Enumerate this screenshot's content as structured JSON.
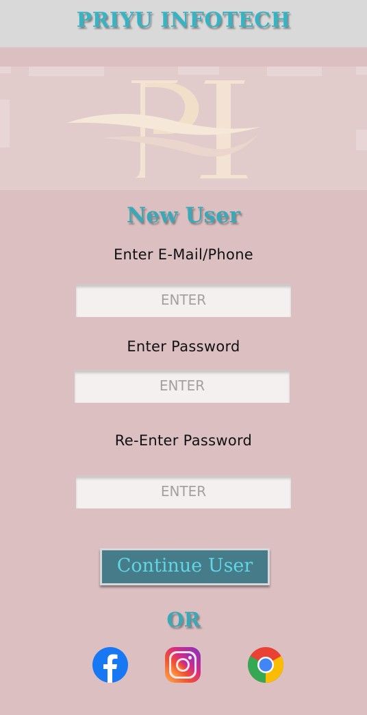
{
  "header": {
    "title": "PRIYU INFOTECH"
  },
  "banner": {
    "logo_icon": "pi-monogram-logo-icon"
  },
  "form": {
    "title": "New User",
    "email_label": "Enter E-Mail/Phone",
    "email_placeholder": "ENTER",
    "password_label": "Enter Password",
    "password_placeholder": "ENTER",
    "repassword_label": "Re-Enter Password",
    "repassword_placeholder": "ENTER",
    "continue_label": "Continue User"
  },
  "alt_login": {
    "or_label": "OR",
    "icons": [
      "facebook-icon",
      "instagram-icon",
      "chrome-icon"
    ]
  },
  "colors": {
    "background": "#dbbfc1",
    "header": "#d9d9d9",
    "accent": "#3aa8b6",
    "button": "#467c89"
  }
}
